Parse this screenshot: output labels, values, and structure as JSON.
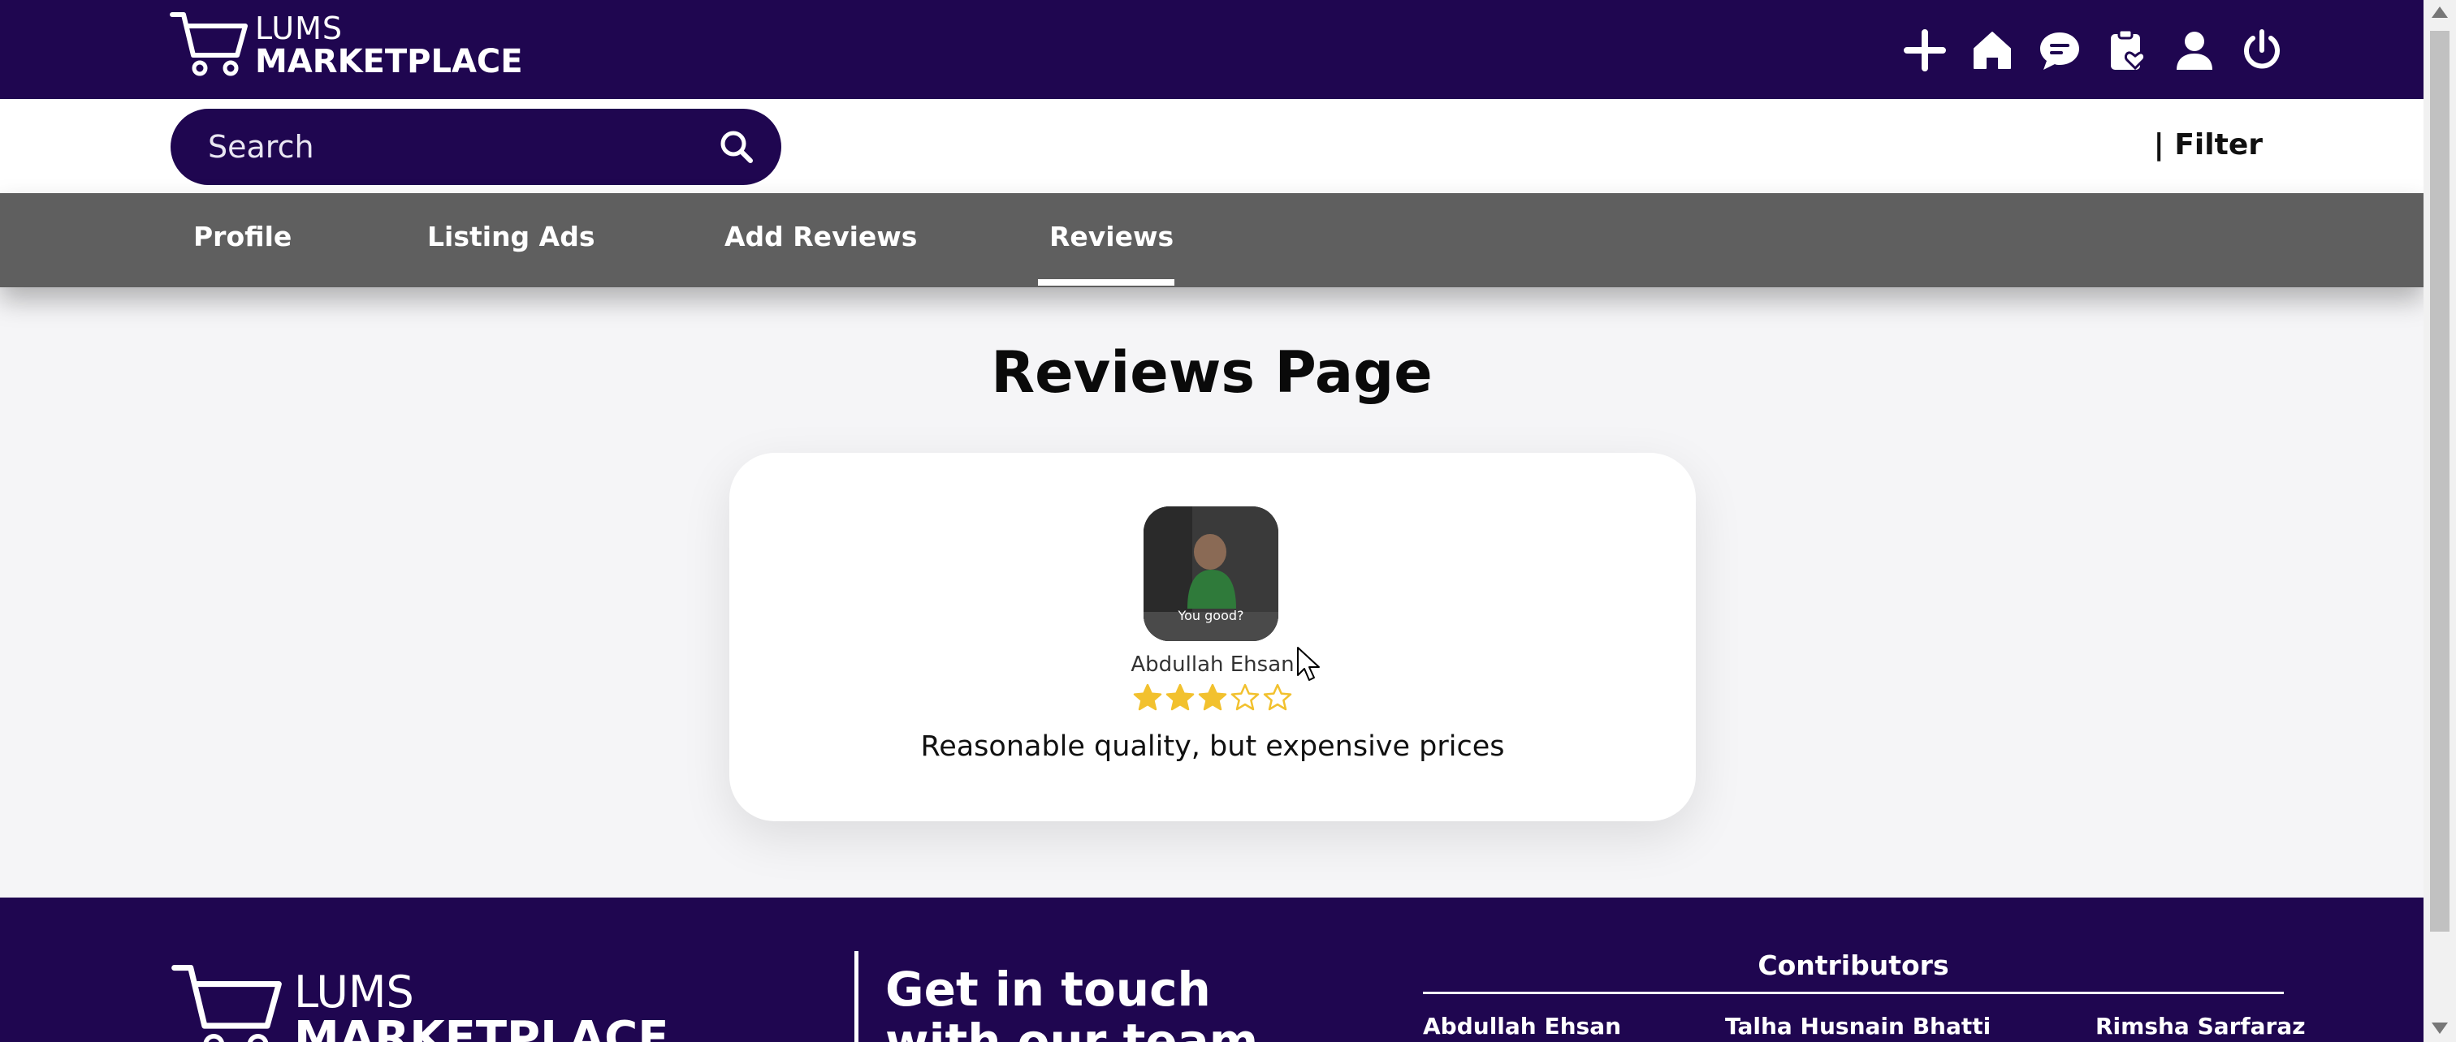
{
  "header": {
    "logo_line1": "LUMS",
    "logo_line2": "MARKETPLACE",
    "icons": [
      "plus-icon",
      "home-icon",
      "chat-icon",
      "clipboard-heart-icon",
      "user-icon",
      "power-icon"
    ]
  },
  "search": {
    "placeholder": "Search",
    "value": ""
  },
  "filter_label": "| Filter",
  "tabs": [
    {
      "label": "Profile",
      "active": false
    },
    {
      "label": "Listing Ads",
      "active": false
    },
    {
      "label": "Add Reviews",
      "active": false
    },
    {
      "label": "Reviews",
      "active": true
    }
  ],
  "main": {
    "title": "Reviews Page",
    "review": {
      "avatar_caption": "You good?",
      "reviewer": "Abdullah Ehsan",
      "rating": 3,
      "rating_max": 5,
      "text": "Reasonable quality, but expensive prices"
    }
  },
  "footer": {
    "logo_line1": "LUMS",
    "logo_line2": "MARKETPLACE",
    "touch_line1": "Get in touch",
    "touch_line2": "with our team",
    "contributors_title": "Contributors",
    "contributors": [
      "Abdullah Ehsan",
      "Talha Husnain Bhatti",
      "Rimsha Sarfaraz"
    ]
  },
  "colors": {
    "brand": "#1f0650",
    "tabbar": "#5f5f5f",
    "star": "#f2c12e"
  }
}
